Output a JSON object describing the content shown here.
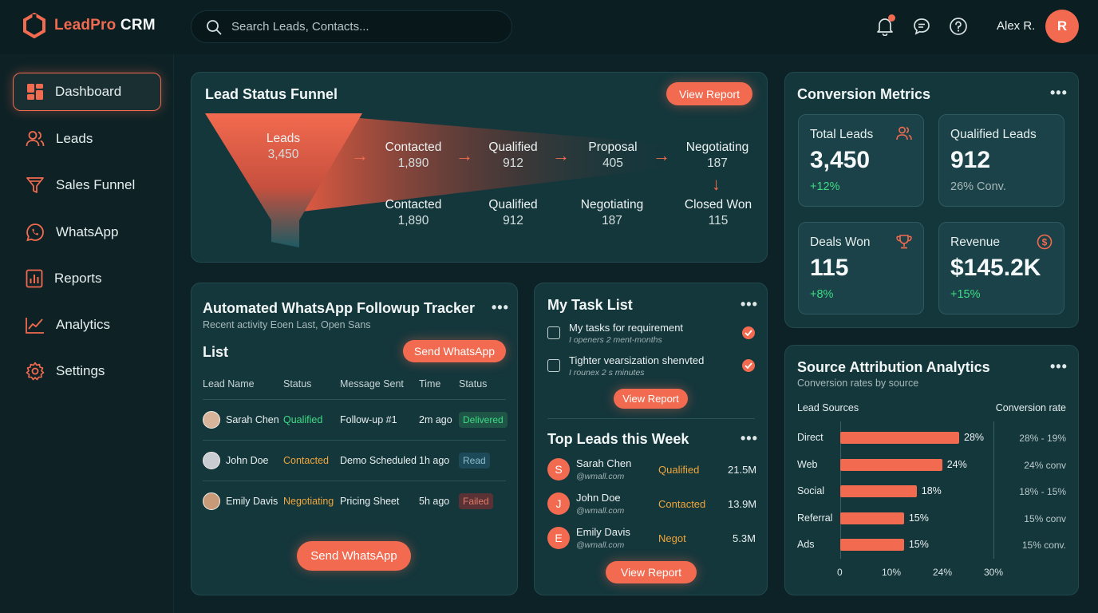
{
  "app": {
    "name_accent": "LeadPro",
    "name_rest": "CRM"
  },
  "search": {
    "placeholder": "Search Leads, Contacts..."
  },
  "user": {
    "name": "Alex R.",
    "initial": "R"
  },
  "sidebar": {
    "items": [
      {
        "label": "Dashboard",
        "icon": "dashboard-icon"
      },
      {
        "label": "Leads",
        "icon": "users-icon"
      },
      {
        "label": "Sales Funnel",
        "icon": "funnel-icon"
      },
      {
        "label": "WhatsApp",
        "icon": "whatsapp-icon"
      },
      {
        "label": "Reports",
        "icon": "reports-icon"
      },
      {
        "label": "Analytics",
        "icon": "analytics-icon"
      },
      {
        "label": "Settings",
        "icon": "settings-icon"
      }
    ]
  },
  "funnel": {
    "title": "Lead Status Funnel",
    "button": "View Report",
    "top_stage": {
      "label": "Leads",
      "value": "3,450"
    },
    "row1": [
      {
        "label": "Contacted",
        "value": "1,890"
      },
      {
        "label": "Qualified",
        "value": "912"
      },
      {
        "label": "Proposal",
        "value": "405"
      },
      {
        "label": "Negotiating",
        "value": "187"
      }
    ],
    "row2": [
      {
        "label": "Contacted",
        "value": "1,890"
      },
      {
        "label": "Qualified",
        "value": "912"
      },
      {
        "label": "Negotiating",
        "value": "187"
      },
      {
        "label": "Closed Won",
        "value": "115"
      }
    ]
  },
  "metrics": {
    "title": "Conversion Metrics",
    "cards": [
      {
        "label": "Total Leads",
        "value": "3,450",
        "delta": "+12%",
        "icon": "users-icon"
      },
      {
        "label": "Qualified Leads",
        "value": "912",
        "delta": "26% Conv.",
        "icon": ""
      },
      {
        "label": "Deals Won",
        "value": "115",
        "delta": "+8%",
        "icon": "trophy-icon"
      },
      {
        "label": "Revenue",
        "value": "$145.2K",
        "delta": "+15%",
        "icon": "dollar-icon"
      }
    ]
  },
  "whatsapp": {
    "title": "Automated WhatsApp Followup Tracker",
    "subtitle": "Recent activity Eoen Last, Open Sans",
    "list_label": "List",
    "send_button": "Send WhatsApp",
    "columns": [
      "Lead Name",
      "Status",
      "Message Sent",
      "Time",
      "Status"
    ],
    "rows": [
      {
        "name": "Sarah Chen",
        "status": "Qualified",
        "message": "Follow-up #1",
        "time": "2m ago",
        "delivery": "Delivered"
      },
      {
        "name": "John Doe",
        "status": "Contacted",
        "message": "Demo Scheduled",
        "time": "1h ago",
        "delivery": "Read"
      },
      {
        "name": "Emily Davis",
        "status": "Negotiating",
        "message": "Pricing Sheet",
        "time": "5h ago",
        "delivery": "Failed"
      }
    ],
    "bottom_button": "Send WhatsApp"
  },
  "tasks": {
    "title": "My Task List",
    "items": [
      {
        "title": "My tasks for requirement",
        "sub": "I openers 2 ment-months"
      },
      {
        "title": "Tighter vearsization shenvted",
        "sub": "I rounex 2 s minutes"
      }
    ],
    "button": "View Report"
  },
  "top_leads": {
    "title": "Top Leads this Week",
    "rows": [
      {
        "initial": "S",
        "name": "Sarah Chen",
        "email": "@wmall.com",
        "status": "Qualified",
        "amount": "21.5M"
      },
      {
        "initial": "J",
        "name": "John Doe",
        "email": "@wmall.com",
        "status": "Contacted",
        "amount": "13.9M"
      },
      {
        "initial": "E",
        "name": "Emily Davis",
        "email": "@wmall.com",
        "status": "Negot",
        "amount": "5.3M"
      }
    ],
    "button": "View Report"
  },
  "sources": {
    "title": "Source Attribution Analytics",
    "subtitle": "Conversion rates by source",
    "left_header": "Lead Sources",
    "right_header": "Conversion rate",
    "rates": [
      "28% - 19%",
      "24% conv",
      "18% - 15%",
      "15% conv",
      "15% conv."
    ]
  },
  "chart_data": {
    "type": "bar",
    "orientation": "horizontal",
    "categories": [
      "Direct",
      "Web",
      "Social",
      "Referral",
      "Ads"
    ],
    "values": [
      28,
      24,
      18,
      15,
      15
    ],
    "value_labels": [
      "28%",
      "24%",
      "18%",
      "15%",
      "15%"
    ],
    "xlim": [
      0,
      30
    ],
    "xticks": [
      "0",
      "10%",
      "24%",
      "30%"
    ],
    "bar_color": "#f26a4f"
  },
  "colors": {
    "accent": "#f26a4f",
    "success": "#3ddc84",
    "warning": "#f0a63a",
    "background": "#0c2226",
    "card": "#14373c"
  }
}
